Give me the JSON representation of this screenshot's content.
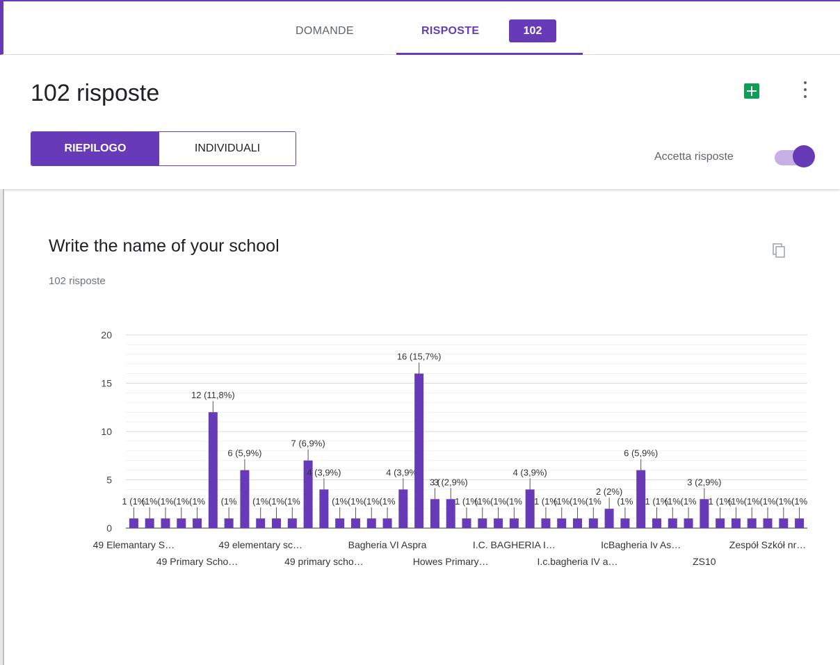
{
  "tabs": {
    "questions": "DOMANDE",
    "responses": "RISPOSTE",
    "response_count": "102"
  },
  "header": {
    "title": "102 risposte",
    "summary_tab": "RIEPILOGO",
    "individual_tab": "INDIVIDUALI",
    "accept_label": "Accetta risposte",
    "accept_enabled": true,
    "sheets_icon": "google-sheets-icon",
    "more_icon": "more-vert-icon"
  },
  "question": {
    "title": "Write the name of your school",
    "subtitle": "102 risposte",
    "copy_icon": "copy-icon"
  },
  "colors": {
    "accent": "#673ab7",
    "sheets": "#0f9d58"
  },
  "chart_data": {
    "type": "bar",
    "ylim": [
      0,
      20
    ],
    "yticks": [
      0,
      5,
      10,
      15,
      20
    ],
    "grid": true,
    "values": [
      1,
      1,
      1,
      1,
      1,
      12,
      1,
      6,
      1,
      1,
      1,
      7,
      4,
      1,
      1,
      1,
      1,
      4,
      16,
      3,
      3,
      1,
      1,
      1,
      1,
      4,
      1,
      1,
      1,
      1,
      2,
      1,
      6,
      1,
      1,
      1,
      3,
      1,
      1,
      1,
      1,
      1,
      1
    ],
    "value_labels": [
      "1 (1%",
      "(1%",
      "(1%",
      "(1%",
      "(1%",
      "12 (11,8%)",
      "(1%",
      "6 (5,9%)",
      "(1%",
      "(1%",
      "(1%",
      "7 (6,9%)",
      "4 (3,9%)",
      "(1%",
      "(1%",
      "(1%",
      "(1%",
      "4 (3,9%)",
      "16 (15,7%)",
      "3 (",
      "3 (2,9%)",
      "1 (1%",
      "(1%",
      "(1%",
      "(1%",
      "4 (3,9%)",
      "1 (1%",
      "(1%",
      "(1%",
      "(1%",
      "2 (2%)",
      "(1%",
      "6 (5,9%)",
      "1 (1%",
      "(1%",
      "(1%",
      "3 (2,9%)",
      "1 (1%",
      "(1%",
      "(1%",
      "(1%",
      "(1%",
      "(1%"
    ],
    "category_labels": [
      {
        "index": 0,
        "row": 0,
        "text": "49 Elemantary S…"
      },
      {
        "index": 4,
        "row": 1,
        "text": "49 Primary Scho…"
      },
      {
        "index": 8,
        "row": 0,
        "text": "49 elementary sc…"
      },
      {
        "index": 12,
        "row": 1,
        "text": "49 primary scho…"
      },
      {
        "index": 16,
        "row": 0,
        "text": "Bagheria VI Aspra"
      },
      {
        "index": 20,
        "row": 1,
        "text": "Howes Primary…"
      },
      {
        "index": 24,
        "row": 0,
        "text": "I.C. BAGHERIA I…"
      },
      {
        "index": 28,
        "row": 1,
        "text": "I.c.bagheria IV a…"
      },
      {
        "index": 32,
        "row": 0,
        "text": "IcBagheria Iv As…"
      },
      {
        "index": 36,
        "row": 1,
        "text": "ZS10"
      },
      {
        "index": 40,
        "row": 0,
        "text": "Zespół Szkół nr…"
      }
    ]
  }
}
